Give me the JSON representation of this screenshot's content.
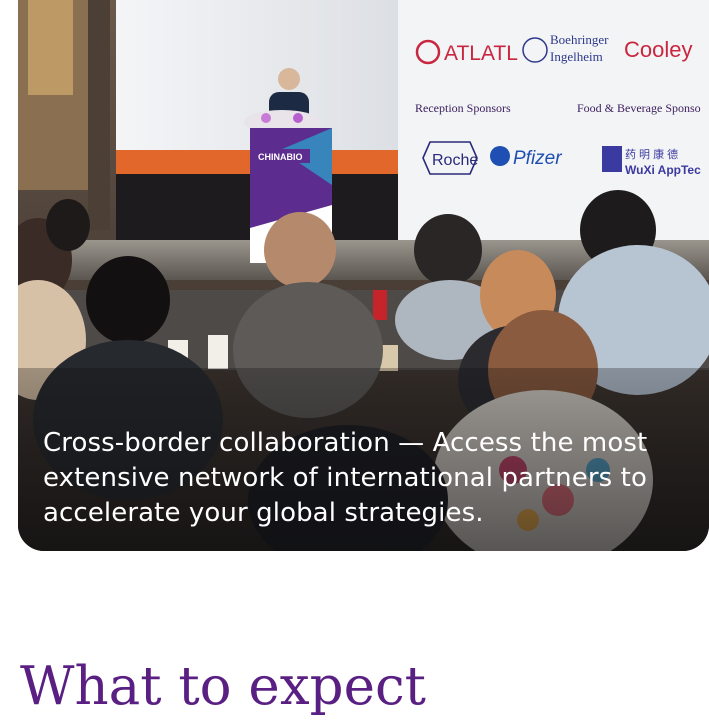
{
  "hero": {
    "caption": "Cross-border collaboration — Access the most extensive network of international partners to accelerate your global strategies.",
    "photo_icon": "conference-photo",
    "backdrop_text": {
      "company_1": "ATLATL",
      "company_2_line1": "Boehringer",
      "company_2_line2": "Ingelheim",
      "company_3": "Cooley",
      "reception_sponsors": "Reception Sponsors",
      "food_sponsors": "Food & Beverage Sponso",
      "sponsor_roche": "Roche",
      "sponsor_pfizer": "Pfizer",
      "sponsor_wuxi_cn": "药 明 康 德",
      "sponsor_wuxi": "WuXi AppTec",
      "podium_brand": "CHINABIO"
    }
  },
  "section": {
    "title": "What to expect"
  }
}
